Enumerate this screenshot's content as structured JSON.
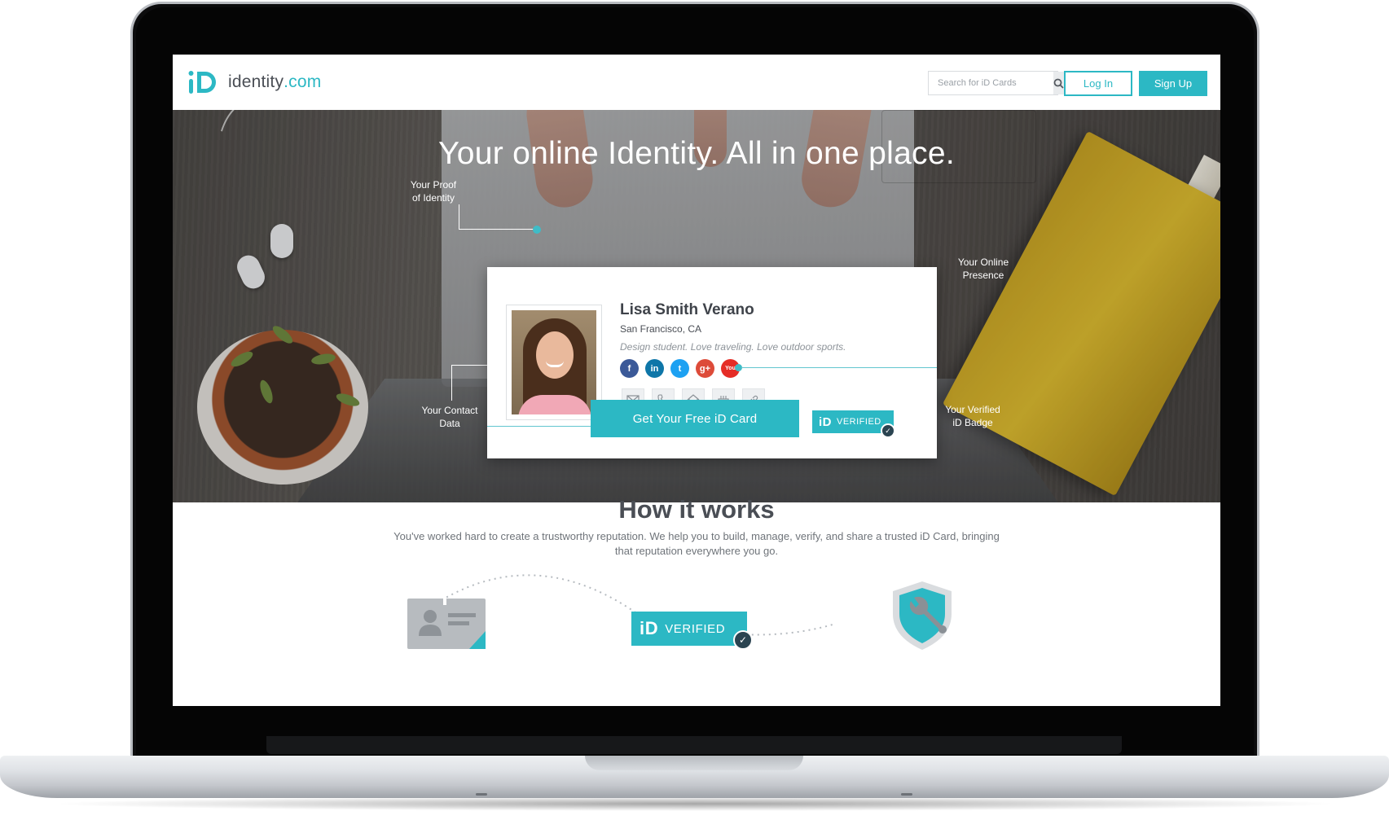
{
  "header": {
    "logo_text": "identity",
    "logo_suffix": ".com",
    "search_placeholder": "Search for iD Cards",
    "login_label": "Log In",
    "signup_label": "Sign Up"
  },
  "hero": {
    "title": "Your online Identity. All in one place.",
    "annotations": {
      "proof_line1": "Your Proof",
      "proof_line2": "of Identity",
      "presence_line1": "Your Online",
      "presence_line2": "Presence",
      "contact_line1": "Your Contact",
      "contact_line2": "Data",
      "badge_line1": "Your Verified",
      "badge_line2": "iD Badge"
    },
    "card": {
      "name": "Lisa Smith Verano",
      "location": "San Francisco, CA",
      "bio": "Design student. Love traveling. Love outdoor sports.",
      "socials": [
        {
          "name": "facebook-icon",
          "glyph": "f",
          "color": "#3b5998"
        },
        {
          "name": "linkedin-icon",
          "glyph": "in",
          "color": "#0e76a8"
        },
        {
          "name": "twitter-icon",
          "glyph": "t",
          "color": "#1da1f2"
        },
        {
          "name": "google-plus-icon",
          "glyph": "g+",
          "color": "#dd4b39"
        },
        {
          "name": "youtube-icon",
          "glyph": "You",
          "color": "#e52d27"
        }
      ],
      "contacts": [
        "mail-icon",
        "phone-icon",
        "home-icon",
        "birthday-cake-icon",
        "link-icon"
      ],
      "verified_label": "VERIFIED",
      "verified_mark": "iD"
    },
    "cta_label": "Get Your Free iD Card"
  },
  "how": {
    "title": "How it works",
    "text": "You've worked hard to create a trustworthy reputation. We help you to build, manage, verify, and share a trusted iD Card, bringing that reputation everywhere you go.",
    "verified_label": "VERIFIED",
    "verified_mark": "iD"
  },
  "colors": {
    "brand": "#2cb8c4",
    "check_badge": "#2b4451"
  }
}
